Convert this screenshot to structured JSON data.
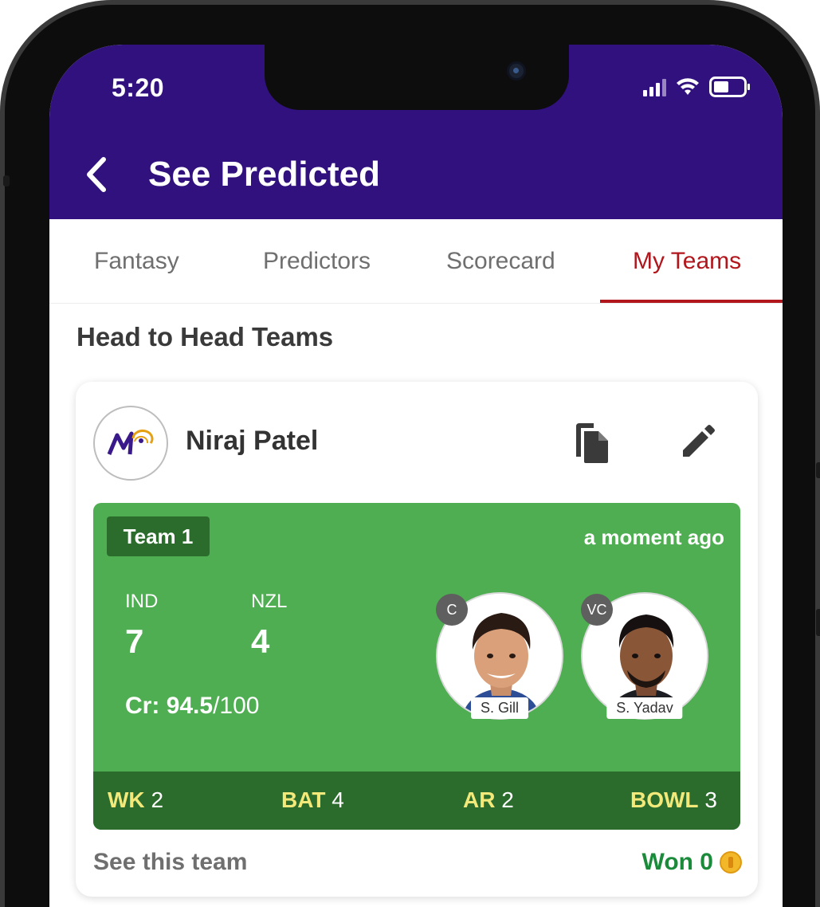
{
  "status_bar": {
    "time": "5:20"
  },
  "header": {
    "title": "See Predicted"
  },
  "tabs": [
    {
      "label": "Fantasy",
      "active": false
    },
    {
      "label": "Predictors",
      "active": false
    },
    {
      "label": "Scorecard",
      "active": false
    },
    {
      "label": "My Teams",
      "active": true
    }
  ],
  "section": {
    "title": "Head to Head Teams"
  },
  "team_card": {
    "user_name": "Niraj Patel",
    "team_label": "Team 1",
    "timestamp": "a moment ago",
    "teams": [
      {
        "code": "IND",
        "count": "7"
      },
      {
        "code": "NZL",
        "count": "4"
      }
    ],
    "credits": {
      "prefix": "Cr:",
      "used": "94.5",
      "total": "/100"
    },
    "captain": {
      "role": "C",
      "name": "S. Gill"
    },
    "vice_captain": {
      "role": "VC",
      "name": "S. Yadav"
    },
    "roles": [
      {
        "label": "WK",
        "count": "2"
      },
      {
        "label": "BAT",
        "count": "4"
      },
      {
        "label": "AR",
        "count": "2"
      },
      {
        "label": "BOWL",
        "count": "3"
      }
    ],
    "see_team_label": "See this team",
    "won_label": "Won 0"
  },
  "colors": {
    "header_bg": "#31117d",
    "active_tab": "#b1161c",
    "field_green": "#4fad52",
    "badge_green": "#2b6c2d",
    "won_green": "#1b8a3a"
  },
  "icons": [
    "back-arrow-icon",
    "copy-icon",
    "edit-pencil-icon",
    "coin-icon",
    "signal-icon",
    "wifi-icon",
    "battery-icon"
  ]
}
